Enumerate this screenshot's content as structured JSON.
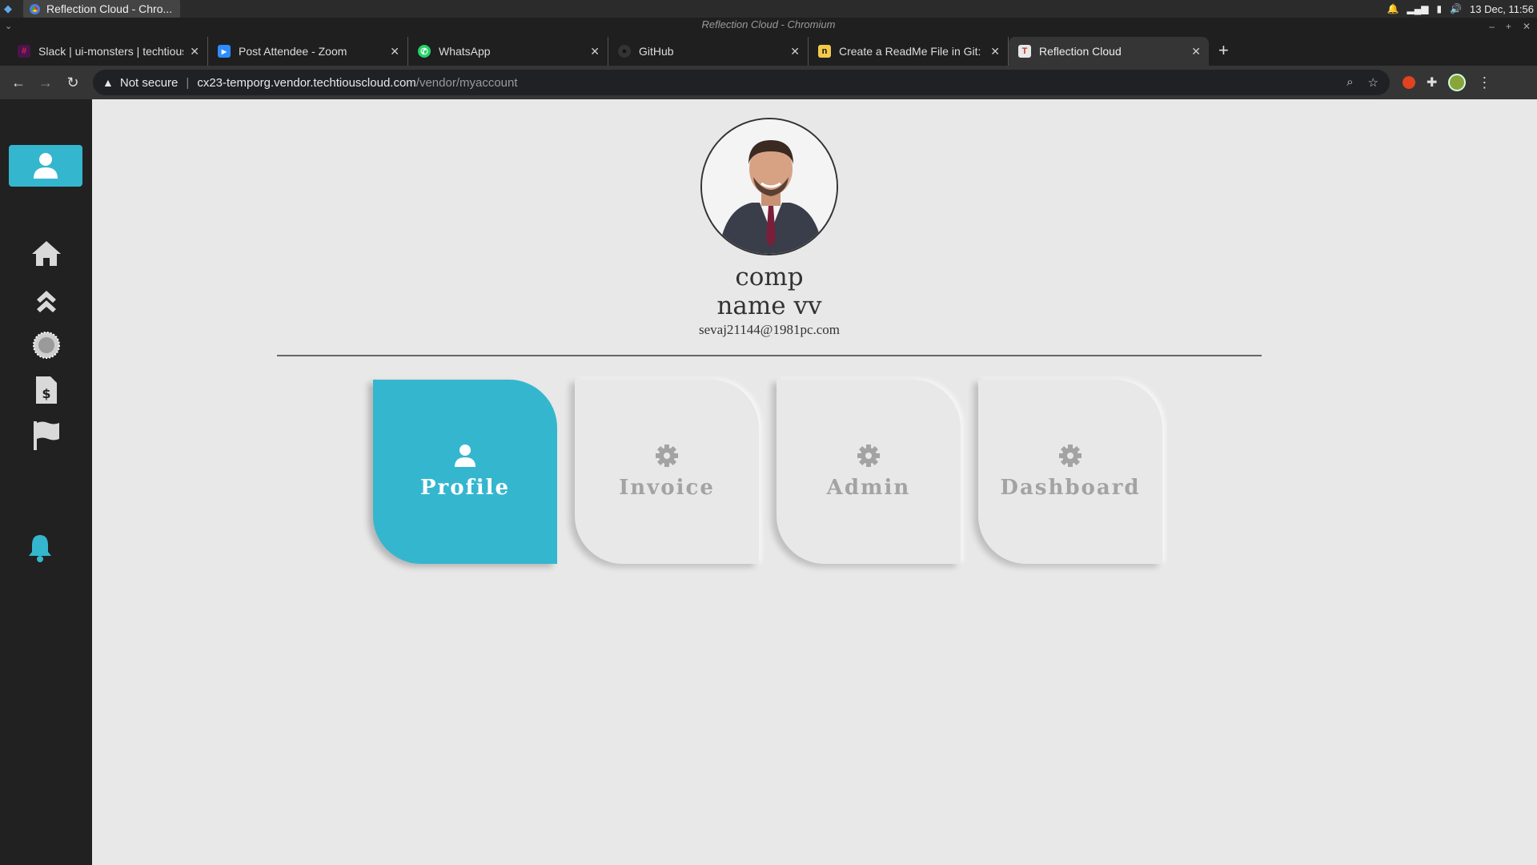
{
  "os": {
    "task_title": "Reflection Cloud - Chro...",
    "datetime": "13 Dec, 11:56"
  },
  "window": {
    "title": "Reflection Cloud - Chromium"
  },
  "tabs": [
    {
      "title": "Slack | ui-monsters | techtious",
      "fav_color": "#4a154b",
      "fav_glyph": "#"
    },
    {
      "title": "Post Attendee - Zoom",
      "fav_color": "#2d8cff",
      "fav_glyph": "▶"
    },
    {
      "title": "WhatsApp",
      "fav_color": "#25d366",
      "fav_glyph": "✆"
    },
    {
      "title": "GitHub",
      "fav_color": "#333333",
      "fav_glyph": "●"
    },
    {
      "title": "Create a ReadMe File in Git: F",
      "fav_color": "#f2c94c",
      "fav_glyph": "n"
    },
    {
      "title": "Reflection Cloud",
      "fav_color": "#e8e8e8",
      "fav_glyph": "T"
    }
  ],
  "address": {
    "security": "Not secure",
    "host": "cx23-temporg.vendor.techtiouscloud.com",
    "path": "/vendor/myaccount"
  },
  "profile": {
    "name_line1": "comp",
    "name_line2": "name vv",
    "email": "sevaj21144@1981pc.com"
  },
  "cards": [
    {
      "label": "Profile",
      "icon": "user-icon",
      "active": true
    },
    {
      "label": "Invoice",
      "icon": "gear-icon",
      "active": false
    },
    {
      "label": "Admin",
      "icon": "gear-icon",
      "active": false
    },
    {
      "label": "Dashboard",
      "icon": "gear-icon",
      "active": false
    }
  ],
  "colors": {
    "accent": "#35b6cf",
    "sidebar": "#212121",
    "background": "#e8e8e8",
    "inactive_label": "#a3a3a3"
  }
}
